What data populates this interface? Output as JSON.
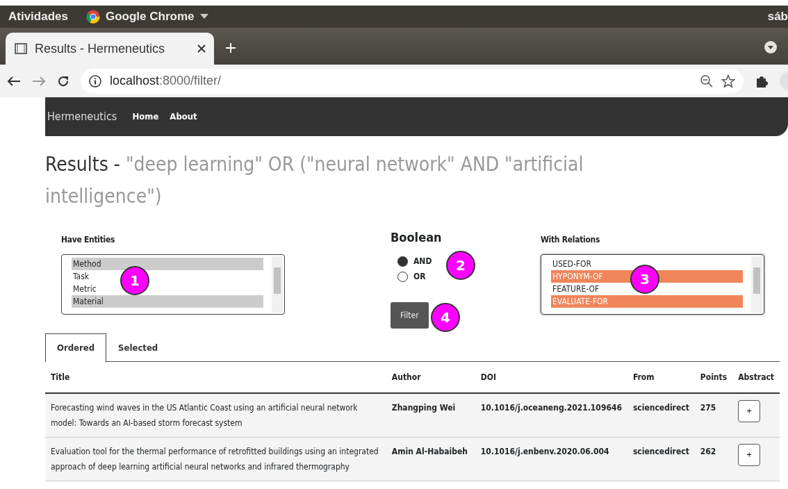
{
  "os_bar": {
    "activities": "Atividades",
    "app": "Google Chrome",
    "clock": "sáb"
  },
  "browser": {
    "tab_title": "Results - Hermeneutics",
    "url_host": "localhost",
    "url_path": ":8000/filter/"
  },
  "navbar": {
    "brand": "Hermeneutics",
    "links": [
      "Home",
      "About"
    ]
  },
  "heading": {
    "title": "Results -",
    "query": "\"deep learning\" OR (\"neural network\" AND \"artificial intelligence\")"
  },
  "entities": {
    "label": "Have Entities",
    "options": [
      {
        "label": "Method",
        "selected": true
      },
      {
        "label": "Task",
        "selected": false
      },
      {
        "label": "Metric",
        "selected": false
      },
      {
        "label": "Material",
        "selected": true
      }
    ]
  },
  "boolean": {
    "label": "Boolean",
    "options": [
      {
        "label": "AND",
        "selected": true
      },
      {
        "label": "OR",
        "selected": false
      }
    ]
  },
  "relations": {
    "label": "With Relations",
    "options": [
      {
        "label": "USED-FOR",
        "selected": false
      },
      {
        "label": "HYPONYM-OF",
        "selected": true
      },
      {
        "label": "FEATURE-OF",
        "selected": false
      },
      {
        "label": "EVALUATE-FOR",
        "selected": true
      }
    ]
  },
  "filter_button": "Filter",
  "tabs": [
    {
      "label": "Ordered",
      "selected": true
    },
    {
      "label": "Selected",
      "selected": false
    }
  ],
  "table": {
    "columns": [
      "Title",
      "Author",
      "DOI",
      "From",
      "Points",
      "Abstract"
    ],
    "rows": [
      {
        "title": "Forecasting wind waves in the US Atlantic Coast using an artificial neural network model: Towards an AI-based storm forecast system",
        "author": "Zhangping Wei",
        "doi": "10.1016/j.oceaneng.2021.109646",
        "from": "sciencedirect",
        "points": "275",
        "abstract_button": "+"
      },
      {
        "title": "Evaluation tool for the thermal performance of retrofitted buildings using an integrated approach of deep learning artificial neural networks and infrared thermography",
        "author": "Amin Al-Habaibeh",
        "doi": "10.1016/j.enbenv.2020.06.004",
        "from": "sciencedirect",
        "points": "262",
        "abstract_button": "+"
      }
    ]
  },
  "annotations": [
    "1",
    "2",
    "3",
    "4"
  ]
}
